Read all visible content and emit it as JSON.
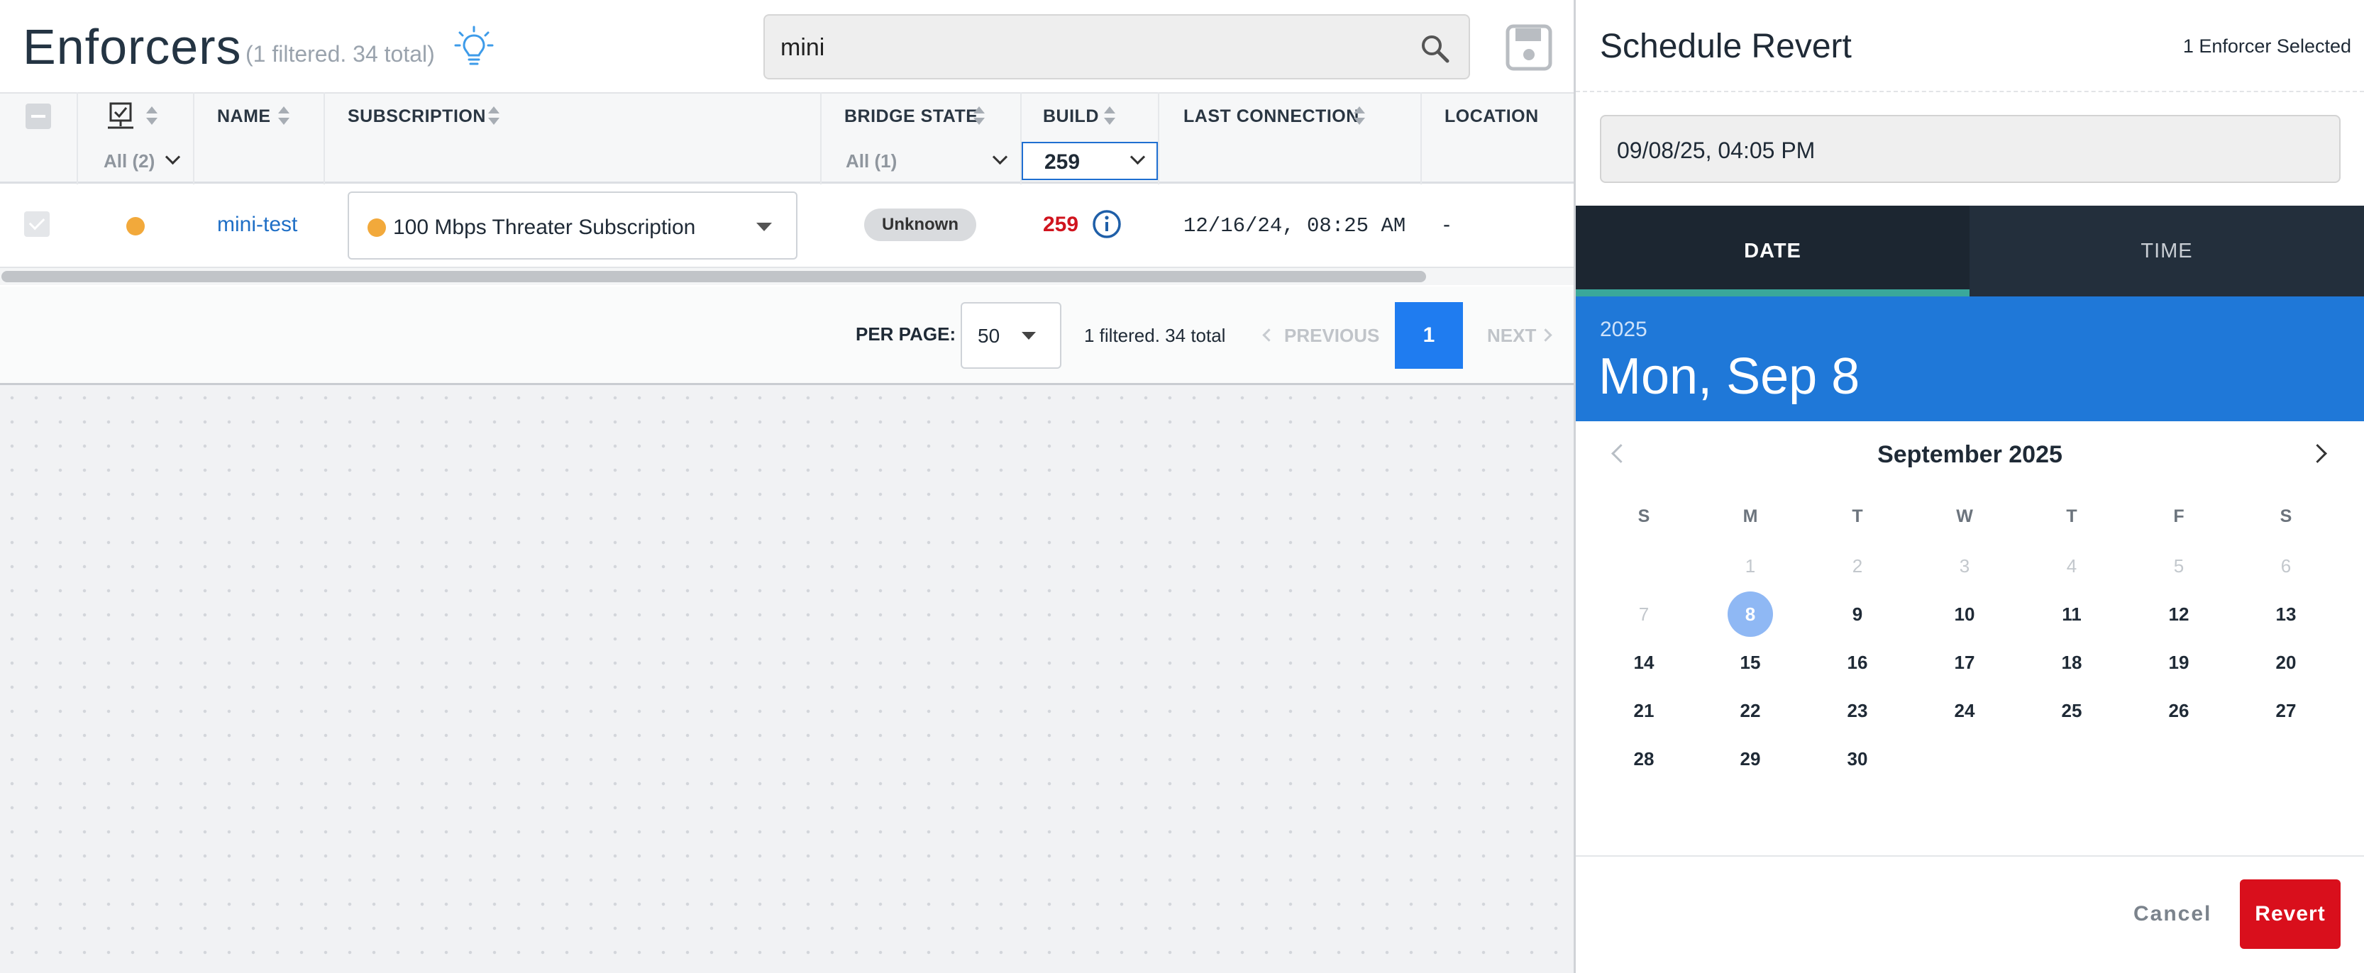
{
  "page": {
    "title": "Enforcers",
    "count_summary": "(1 filtered. 34 total)"
  },
  "search": {
    "value": "mini"
  },
  "table": {
    "columns": [
      "NAME",
      "SUBSCRIPTION",
      "BRIDGE STATE",
      "BUILD",
      "LAST CONNECTION",
      "LOCATION"
    ],
    "filters": {
      "status": "All (2)",
      "bridge_state": "All (1)",
      "build": "259"
    },
    "rows": [
      {
        "name": "mini-test",
        "subscription": "100 Mbps Threater Subscription",
        "bridge_state": "Unknown",
        "build": "259",
        "last_connection": "12/16/24, 08:25 AM",
        "location": "-"
      }
    ]
  },
  "pagination": {
    "per_page_label": "PER PAGE:",
    "per_page_value": "50",
    "count": "1 filtered. 34 total",
    "previous": "PREVIOUS",
    "current_page": "1",
    "next": "NEXT"
  },
  "panel": {
    "title": "Schedule Revert",
    "selected": "1 Enforcer Selected",
    "datetime_value": "09/08/25, 04:05 PM",
    "tabs": {
      "date": "DATE",
      "time": "TIME"
    },
    "year": "2025",
    "big_date": "Mon, Sep 8",
    "month_label": "September 2025",
    "weekdays": [
      "S",
      "M",
      "T",
      "W",
      "T",
      "F",
      "S"
    ],
    "days_dim": [
      "1",
      "2",
      "3",
      "4",
      "5",
      "6",
      "7"
    ],
    "days": [
      "8",
      "9",
      "10",
      "11",
      "12",
      "13",
      "14",
      "15",
      "16",
      "17",
      "18",
      "19",
      "20",
      "21",
      "22",
      "23",
      "24",
      "25",
      "26",
      "27",
      "28",
      "29",
      "30"
    ],
    "selected_day": "8",
    "cancel": "Cancel",
    "revert": "Revert"
  },
  "colors": {
    "accent_blue": "#1f78d8",
    "status_dot": "#f2a93b",
    "danger": "#d90f1c",
    "tab_underline": "#3aa89a"
  },
  "icons": [
    "lightbulb-icon",
    "search-icon",
    "save-icon",
    "select-all-checkbox",
    "device-status-icon",
    "info-icon",
    "chevron-left-icon",
    "chevron-right-icon"
  ]
}
